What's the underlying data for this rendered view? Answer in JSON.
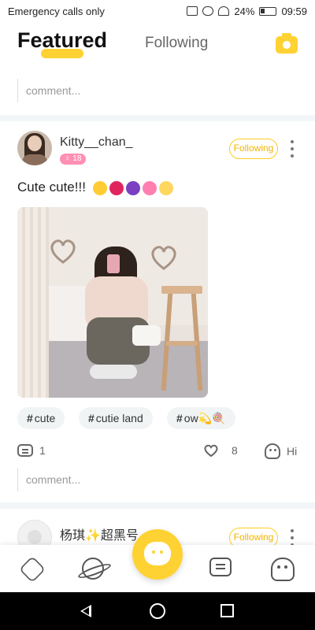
{
  "status_bar": {
    "carrier": "Emergency calls only",
    "battery": "24%",
    "time": "09:59"
  },
  "header": {
    "tab_featured": "Featured",
    "tab_following": "Following",
    "camera_icon": "camera-icon"
  },
  "top_comment": {
    "placeholder": "comment..."
  },
  "post1": {
    "username": "Kitty__chan_",
    "badge": "♀ 18",
    "follow_label": "Following",
    "text": "Cute cute!!!",
    "tags": [
      "cute",
      "cutie land",
      "ow💫🍭"
    ],
    "tag_prefix": "#",
    "comment_count": "1",
    "like_count": "8",
    "hi_label": "Hi",
    "comment_placeholder": "comment..."
  },
  "post2": {
    "username": "杨琪✨超黑号",
    "follow_label": "Following"
  },
  "colors": {
    "accent": "#ffd233",
    "follow": "#f2b400",
    "badge": "#ff8fb3"
  }
}
